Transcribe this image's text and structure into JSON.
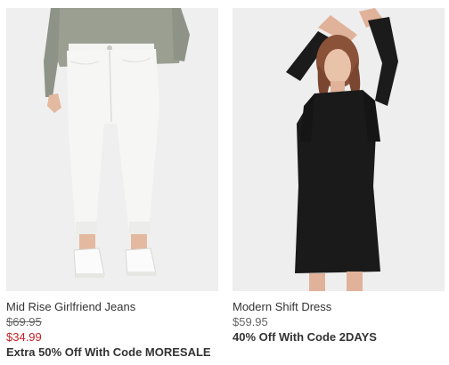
{
  "products": [
    {
      "name": "Mid Rise Girlfriend Jeans",
      "original_price": "$69.95",
      "sale_price": "$34.99",
      "promo": "Extra 50% Off With Code MORESALE",
      "image_alt": "woman wearing white girlfriend jeans and grey sweater"
    },
    {
      "name": "Modern Shift Dress",
      "price": "$59.95",
      "promo": "40% Off With Code 2DAYS",
      "image_alt": "woman wearing black long sleeve shift dress"
    }
  ],
  "colors": {
    "sale_red": "#c41f25",
    "text": "#333333",
    "muted": "#666666",
    "image_bg": "#f0f0f1"
  }
}
